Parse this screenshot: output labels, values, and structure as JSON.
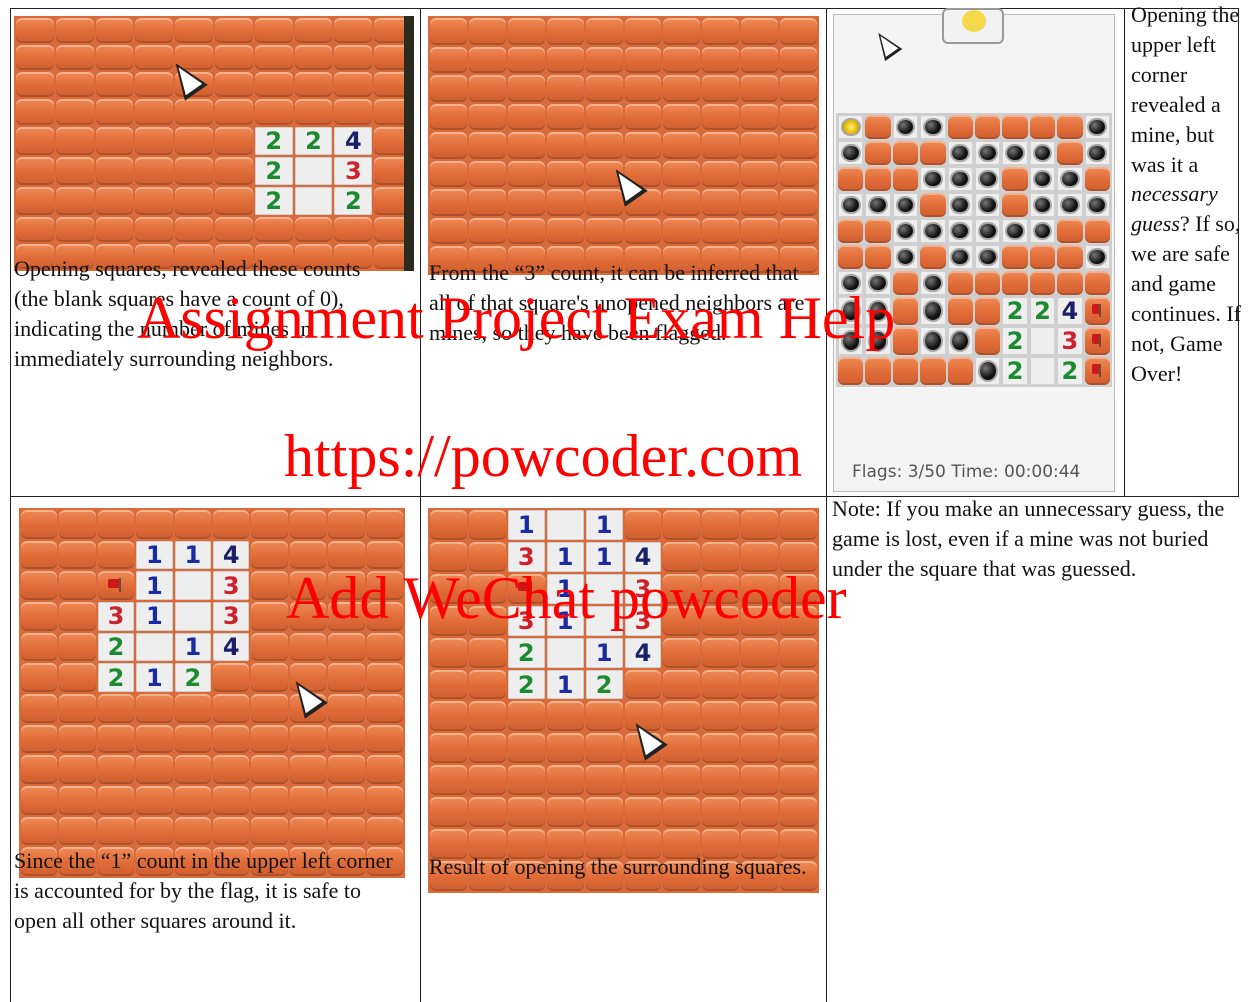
{
  "captions": {
    "c1": "Opening squares, revealed these counts (the blank squares have a count of 0), indicating the number of mines in immediately surrounding neighbors.",
    "c2": "From the “3” count, it can be inferred that all of that square's unopened neighbors are mines, so they have been flagged.",
    "c3_pre": "Opening the upper left corner revealed a mine, but was it a ",
    "c3_em": "necessary guess",
    "c3_post": "?  If so, we are safe and game continues. If not, Game Over!",
    "c4": "Since the “1” count in the upper left corner is accounted for by the flag, it is safe to open all other squares around it.",
    "c5": "Result of opening the surrounding squares.",
    "c6": "Note: If you make an unnecessary guess, the game is lost, even if a mine was not buried under the square that was guessed."
  },
  "game_status": "Flags: 3/50   Time: 00:00:44",
  "watermark": {
    "line1": "Assignment Project Exam Help",
    "line2": "https://powcoder.com",
    "line3": "Add WeChat powcoder"
  },
  "boards": {
    "b1": {
      "cols": 10,
      "rows": 9,
      "open": {
        "6,4": "2",
        "7,4": "2",
        "8,4": "4",
        "6,5": "2",
        "7,5": "0",
        "8,5": "3",
        "6,6": "2",
        "7,6": "0",
        "8,6": "2"
      }
    },
    "b2": {
      "cols": 10,
      "rows": 9,
      "open": {}
    },
    "b4": {
      "cols": 10,
      "rows": 12,
      "open": {
        "3,1": "1",
        "4,1": "1",
        "5,1": "4",
        "2,2": "F",
        "3,2": "1",
        "4,2": "0",
        "5,2": "3",
        "2,3": "3",
        "3,3": "1",
        "4,3": "0",
        "5,3": "3",
        "2,4": "2",
        "3,4": "0",
        "4,4": "1",
        "5,4": "4",
        "2,5": "2",
        "3,5": "1",
        "4,5": "2"
      }
    },
    "b5": {
      "cols": 10,
      "rows": 12,
      "open": {
        "2,0": "1",
        "3,0": "0",
        "4,0": "1",
        "2,1": "3",
        "3,1": "1",
        "4,1": "1",
        "5,1": "4",
        "2,2": "F",
        "3,2": "1",
        "4,2": "0",
        "5,2": "3",
        "2,3": "3",
        "3,3": "1",
        "4,3": "0",
        "5,3": "3",
        "2,4": "2",
        "3,4": "0",
        "4,4": "1",
        "5,4": "4",
        "2,5": "2",
        "3,5": "1",
        "4,5": "2"
      }
    },
    "b3": {
      "cols": 10,
      "rows": 10,
      "open": {
        "0,0": "X",
        "2,0": "M",
        "3,0": "M",
        "9,0": "M",
        "0,1": "M",
        "4,1": "M",
        "5,1": "M",
        "6,1": "M",
        "7,1": "M",
        "9,1": "M",
        "3,2": "M",
        "4,2": "M",
        "5,2": "M",
        "7,2": "M",
        "8,2": "M",
        "0,3": "M",
        "1,3": "M",
        "2,3": "M",
        "4,3": "M",
        "5,3": "M",
        "7,3": "M",
        "8,3": "M",
        "9,3": "M",
        "2,4": "M",
        "3,4": "M",
        "4,4": "M",
        "5,4": "M",
        "6,4": "M",
        "7,4": "M",
        "2,5": "M",
        "4,5": "M",
        "5,5": "M",
        "9,5": "M",
        "0,6": "M",
        "1,6": "M",
        "3,6": "M",
        "0,7": "M",
        "1,7": "M",
        "3,7": "M",
        "6,7": "2",
        "7,7": "2",
        "8,7": "4",
        "9,7": "F",
        "0,8": "M",
        "1,8": "M",
        "3,8": "M",
        "4,8": "M",
        "6,8": "2",
        "7,8": "0",
        "8,8": "3",
        "9,8": "F",
        "5,9": "M",
        "6,9": "2",
        "7,9": "0",
        "8,9": "2",
        "9,9": "F"
      }
    }
  }
}
